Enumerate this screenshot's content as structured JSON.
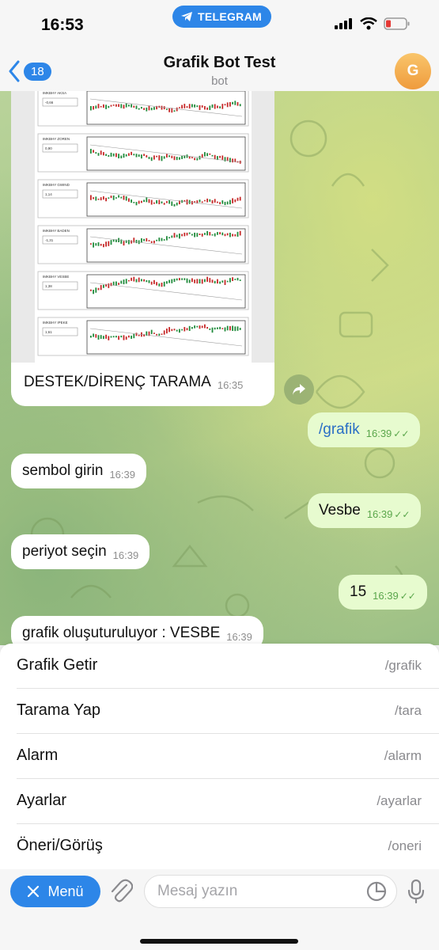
{
  "status_bar": {
    "time": "16:53",
    "app_pill": "TELEGRAM"
  },
  "header": {
    "back_count": "18",
    "title": "Grafik Bot Test",
    "subtitle": "bot",
    "avatar_letter": "G"
  },
  "photo_message": {
    "image_rows": [
      "IMKBHY AKSA",
      "IMKBHY ZOREN",
      "IMKBHY GWIND",
      "IMKBHY BADEN",
      "IMKBHY VESBE",
      "IMKBHY IPEKE"
    ],
    "image_values": [
      "-0,66",
      "0,90",
      "1,14",
      "-1,31",
      "1,38",
      "1,61"
    ],
    "caption": "DESTEK/DİRENÇ TARAMA",
    "time": "16:35"
  },
  "messages": [
    {
      "side": "out",
      "text": "/grafik",
      "time": "16:39",
      "is_command": true
    },
    {
      "side": "in",
      "text": "sembol girin",
      "time": "16:39"
    },
    {
      "side": "out",
      "text": "Vesbe",
      "time": "16:39"
    },
    {
      "side": "in",
      "text": "periyot seçin",
      "time": "16:39"
    },
    {
      "side": "out",
      "text": "15",
      "time": "16:39"
    },
    {
      "side": "in",
      "text": "grafik oluşuturuluyor : VESBE",
      "time": "16:39"
    }
  ],
  "command_menu": [
    {
      "label": "Grafik Getir",
      "command": "/grafik"
    },
    {
      "label": "Tarama Yap",
      "command": "/tara"
    },
    {
      "label": "Alarm",
      "command": "/alarm"
    },
    {
      "label": "Ayarlar",
      "command": "/ayarlar"
    },
    {
      "label": "Öneri/Görüş",
      "command": "/oneri"
    }
  ],
  "input_bar": {
    "menu_label": "Menü",
    "placeholder": "Mesaj yazın"
  },
  "colors": {
    "accent": "#2d86e8",
    "outgoing_bubble": "#e7fbcf",
    "incoming_bubble": "#ffffff"
  }
}
